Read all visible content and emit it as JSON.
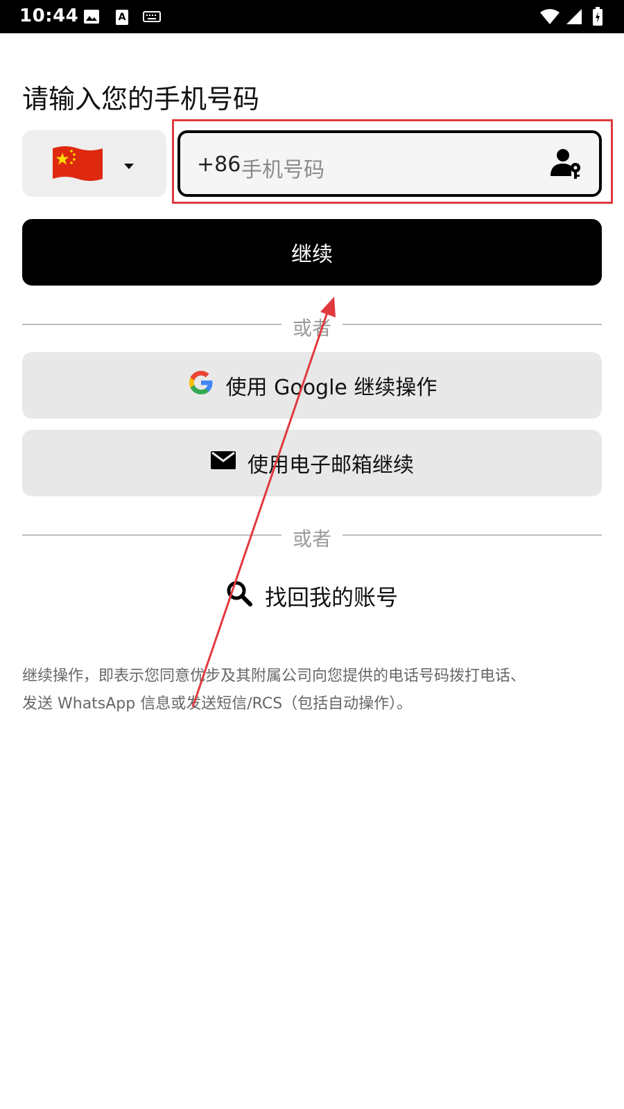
{
  "status_bar": {
    "time": "10:44",
    "left_icons": [
      "image-icon",
      "font-a-icon",
      "keyboard-icon"
    ],
    "right_icons": [
      "wifi-icon",
      "cell-signal-icon",
      "battery-icon"
    ]
  },
  "page": {
    "title": "请输入您的手机号码"
  },
  "country_picker": {
    "flag": "china-flag-icon",
    "dropdown_icon": "caret-down-icon"
  },
  "phone_field": {
    "dial_code": "+86",
    "placeholder": "手机号码",
    "trailing_icon": "contact-key-icon"
  },
  "continue_button": {
    "label": "继续"
  },
  "dividers": {
    "first": "或者",
    "second": "或者"
  },
  "google_button": {
    "icon": "google-icon",
    "label": "使用 Google 继续操作"
  },
  "email_button": {
    "icon": "mail-icon",
    "label": "使用电子邮箱继续"
  },
  "recover_account": {
    "icon": "search-icon",
    "label": "找回我的账号"
  },
  "legal": {
    "line1": "继续操作，即表示您同意优步及其附属公司向您提供的电话号码拨打电话、",
    "line2": "发送 WhatsApp 信息或发送短信/RCS（包括自动操作）。"
  },
  "colors": {
    "annotation": "#e0393e",
    "primary_button": "#000000",
    "secondary_button": "#e8e8e8"
  }
}
